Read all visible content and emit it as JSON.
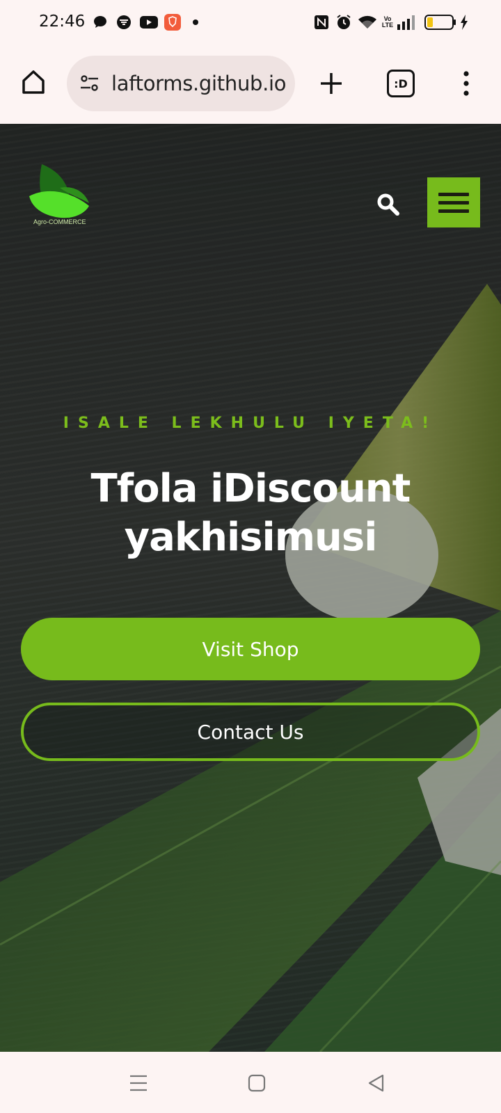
{
  "status_bar": {
    "time": "22:46",
    "icons_left": [
      "chat-bubble-icon",
      "vpn-shield-icon",
      "youtube-icon",
      "brave-icon",
      "notification-dot"
    ],
    "icons_right": [
      "nfc-icon",
      "alarm-icon",
      "wifi-icon",
      "volte-icon",
      "signal-icon",
      "battery-icon",
      "charging-icon"
    ],
    "volte_label": "Vo\nLTE"
  },
  "browser": {
    "url": "laftorms.github.io",
    "tab_button_label": ":D",
    "icons": [
      "home-icon",
      "site-settings-icon",
      "new-tab-icon",
      "tab-switcher-icon",
      "more-menu-icon"
    ]
  },
  "site": {
    "logo_text": "Agro-COMMERCE",
    "eyebrow": "ISALE LEKHULU IYETA!",
    "headline": "Tfola iDiscount yakhisimusi",
    "primary_button": "Visit Shop",
    "secondary_button": "Contact Us",
    "accent_color": "#77bb1c"
  },
  "nav_bar": {
    "icons": [
      "recents-icon",
      "home-nav-icon",
      "back-icon"
    ]
  }
}
